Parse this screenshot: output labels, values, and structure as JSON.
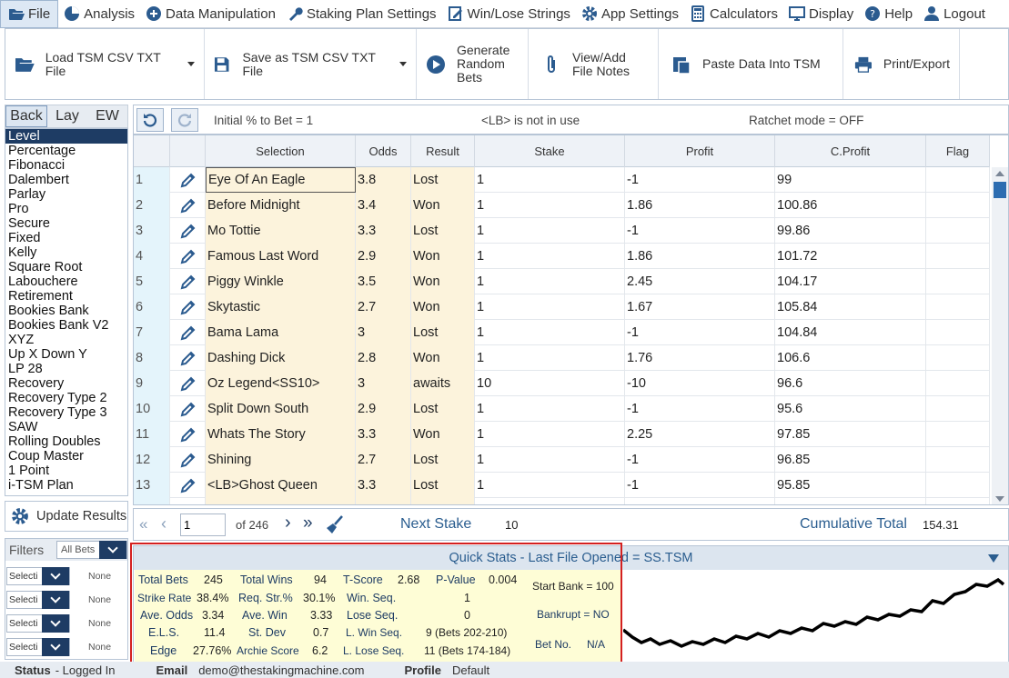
{
  "menu": {
    "file": "File",
    "analysis": "Analysis",
    "data_manipulation": "Data Manipulation",
    "staking_plan_settings": "Staking Plan Settings",
    "win_lose_strings": "Win/Lose Strings",
    "app_settings": "App Settings",
    "calculators": "Calculators",
    "display": "Display",
    "help": "Help",
    "logout": "Logout"
  },
  "toolbar": {
    "load": "Load TSM CSV TXT File",
    "save": "Save as TSM CSV TXT File",
    "generate_1": "Generate",
    "generate_2": "Random",
    "generate_3": "Bets",
    "notes_1": "View/Add",
    "notes_2": "File Notes",
    "paste": "Paste Data Into TSM",
    "print": "Print/Export"
  },
  "left_tabs": [
    "Back",
    "Lay",
    "EW"
  ],
  "plans": [
    "Level",
    "Percentage",
    "Fibonacci",
    "Dalembert",
    "Parlay",
    "Pro",
    "Secure",
    "Fixed",
    "Kelly",
    "Square Root",
    "Labouchere",
    "Retirement",
    "Bookies Bank",
    "Bookies Bank V2",
    "XYZ",
    "Up X Down Y",
    "LP 28",
    "Recovery",
    "Recovery Type 2",
    "Recovery Type 3",
    "SAW",
    "Rolling Doubles",
    "Coup Master",
    "1 Point",
    "i-TSM Plan"
  ],
  "update_button": "Update Results",
  "filters": {
    "title": "Filters",
    "all_bets": "All Bets",
    "rows": [
      {
        "select": "Selecti",
        "value": "None"
      },
      {
        "select": "Selecti",
        "value": "None"
      },
      {
        "select": "Selecti",
        "value": "None"
      },
      {
        "select": "Selecti",
        "value": "None"
      }
    ]
  },
  "info": {
    "initial": "Initial % to Bet = 1",
    "lb": "<LB> is not in use",
    "ratchet": "Ratchet mode = OFF"
  },
  "columns": [
    "Selection",
    "Odds",
    "Result",
    "Stake",
    "Profit",
    "C.Profit",
    "Flag"
  ],
  "rows": [
    {
      "n": "1",
      "selection": "Eye Of An Eagle",
      "odds": "3.8",
      "result": "Lost",
      "stake": "1",
      "profit": "-1",
      "cprofit": "99"
    },
    {
      "n": "2",
      "selection": "Before Midnight",
      "odds": "3.4",
      "result": "Won",
      "stake": "1",
      "profit": "1.86",
      "cprofit": "100.86"
    },
    {
      "n": "3",
      "selection": "Mo Tottie",
      "odds": "3.3",
      "result": "Lost",
      "stake": "1",
      "profit": "-1",
      "cprofit": "99.86"
    },
    {
      "n": "4",
      "selection": "Famous Last Word",
      "odds": "2.9",
      "result": "Won",
      "stake": "1",
      "profit": "1.86",
      "cprofit": "101.72"
    },
    {
      "n": "5",
      "selection": "Piggy Winkle",
      "odds": "3.5",
      "result": "Won",
      "stake": "1",
      "profit": "2.45",
      "cprofit": "104.17"
    },
    {
      "n": "6",
      "selection": "Skytastic",
      "odds": "2.7",
      "result": "Won",
      "stake": "1",
      "profit": "1.67",
      "cprofit": "105.84"
    },
    {
      "n": "7",
      "selection": "Bama Lama",
      "odds": "3",
      "result": "Lost",
      "stake": "1",
      "profit": "-1",
      "cprofit": "104.84"
    },
    {
      "n": "8",
      "selection": "Dashing Dick",
      "odds": "2.8",
      "result": "Won",
      "stake": "1",
      "profit": "1.76",
      "cprofit": "106.6"
    },
    {
      "n": "9",
      "selection": "Oz Legend<SS10>",
      "odds": "3",
      "result": "awaits",
      "stake": "10",
      "profit": "-10",
      "cprofit": "96.6"
    },
    {
      "n": "10",
      "selection": "Split Down South",
      "odds": "2.9",
      "result": "Lost",
      "stake": "1",
      "profit": "-1",
      "cprofit": "95.6"
    },
    {
      "n": "11",
      "selection": "Whats The Story",
      "odds": "3.3",
      "result": "Won",
      "stake": "1",
      "profit": "2.25",
      "cprofit": "97.85"
    },
    {
      "n": "12",
      "selection": "Shining",
      "odds": "2.7",
      "result": "Lost",
      "stake": "1",
      "profit": "-1",
      "cprofit": "96.85"
    },
    {
      "n": "13",
      "selection": "<LB>Ghost Queen",
      "odds": "3.3",
      "result": "Lost",
      "stake": "1",
      "profit": "-1",
      "cprofit": "95.85"
    }
  ],
  "pager": {
    "page": "1",
    "of": "of 246",
    "next_stake_label": "Next Stake",
    "next_stake": "10",
    "cum_label": "Cumulative Total",
    "cum_value": "154.31"
  },
  "quickstats": {
    "title": "Quick Stats - Last File Opened = SS.TSM",
    "total_bets_l": "Total Bets",
    "total_bets": "245",
    "total_wins_l": "Total Wins",
    "total_wins": "94",
    "tscore_l": "T-Score",
    "tscore": "2.68",
    "pvalue_l": "P-Value",
    "pvalue": "0.004",
    "strike_l": "Strike Rate",
    "strike": "38.4%",
    "reqstr_l": "Req. Str.%",
    "reqstr": "30.1%",
    "winseq_l": "Win. Seq.",
    "winseq": "1",
    "aveodds_l": "Ave. Odds",
    "aveodds": "3.34",
    "avewin_l": "Ave. Win",
    "avewin": "3.33",
    "loseseq_l": "Lose Seq.",
    "loseseq": "0",
    "els_l": "E.L.S.",
    "els": "11.4",
    "stdev_l": "St. Dev",
    "stdev": "0.7",
    "lwinseq_l": "L. Win Seq.",
    "lwinseq": "9 (Bets 202-210)",
    "edge_l": "Edge",
    "edge": "27.76%",
    "archie_l": "Archie Score",
    "archie": "6.2",
    "lloseseq_l": "L. Lose Seq.",
    "lloseseq": "11 (Bets 174-184)",
    "start_bank": "Start Bank = 100",
    "bankrupt": "Bankrupt = NO",
    "betno_l": "Bet No.",
    "betno": "N/A"
  },
  "status": {
    "label": "Status",
    "value": "- Logged In",
    "email_l": "Email",
    "email": "demo@thestakingmachine.com",
    "profile_l": "Profile",
    "profile": "Default"
  },
  "colors": {
    "navy": "#1e3c64",
    "selection_bg": "#fcf3dc",
    "red_frame": "#d42020"
  }
}
